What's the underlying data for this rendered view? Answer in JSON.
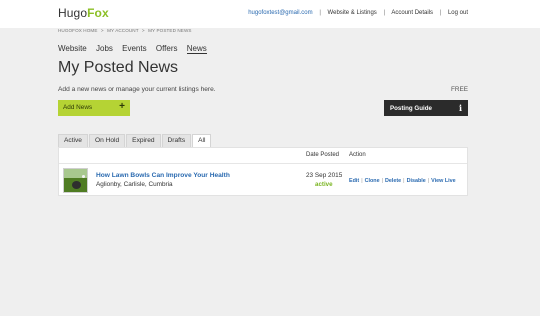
{
  "header": {
    "logo_part1": "Hugo",
    "logo_part2": "Fox",
    "email": "hugofoxtest@gmail.com",
    "nav": [
      "Website & Listings",
      "Account Details",
      "Log out"
    ],
    "separator": "|"
  },
  "breadcrumb": {
    "items": [
      "HUGOFOX HOME",
      "MY ACCOUNT",
      "MY POSTED NEWS"
    ],
    "separator": ">"
  },
  "subnav": {
    "items": [
      "Website",
      "Jobs",
      "Events",
      "Offers",
      "News"
    ],
    "active": "News"
  },
  "page": {
    "title": "My Posted News",
    "description": "Add a new news or manage your current listings here.",
    "plan": "FREE"
  },
  "buttons": {
    "add_news": "Add News",
    "add_icon": "+",
    "posting_guide": "Posting Guide",
    "info_icon": "i"
  },
  "tabs": {
    "items": [
      "Active",
      "On Hold",
      "Expired",
      "Drafts",
      "All"
    ],
    "selected": "All"
  },
  "table": {
    "headers": {
      "date_posted": "Date Posted",
      "action": "Action"
    },
    "rows": [
      {
        "title": "How Lawn Bowls Can Improve Your Health",
        "location": "Aglionby, Carlisle, Cumbria",
        "date": "23 Sep 2015",
        "status": "active",
        "actions": [
          "Edit",
          "Clone",
          "Delete",
          "Disable",
          "View Live"
        ],
        "action_separator": "|"
      }
    ]
  },
  "colors": {
    "accent_green": "#b5d334",
    "link_blue": "#2a6ab0",
    "status_green": "#7ab521",
    "dark_button": "#2b2b2b",
    "page_background": "#efefef"
  }
}
